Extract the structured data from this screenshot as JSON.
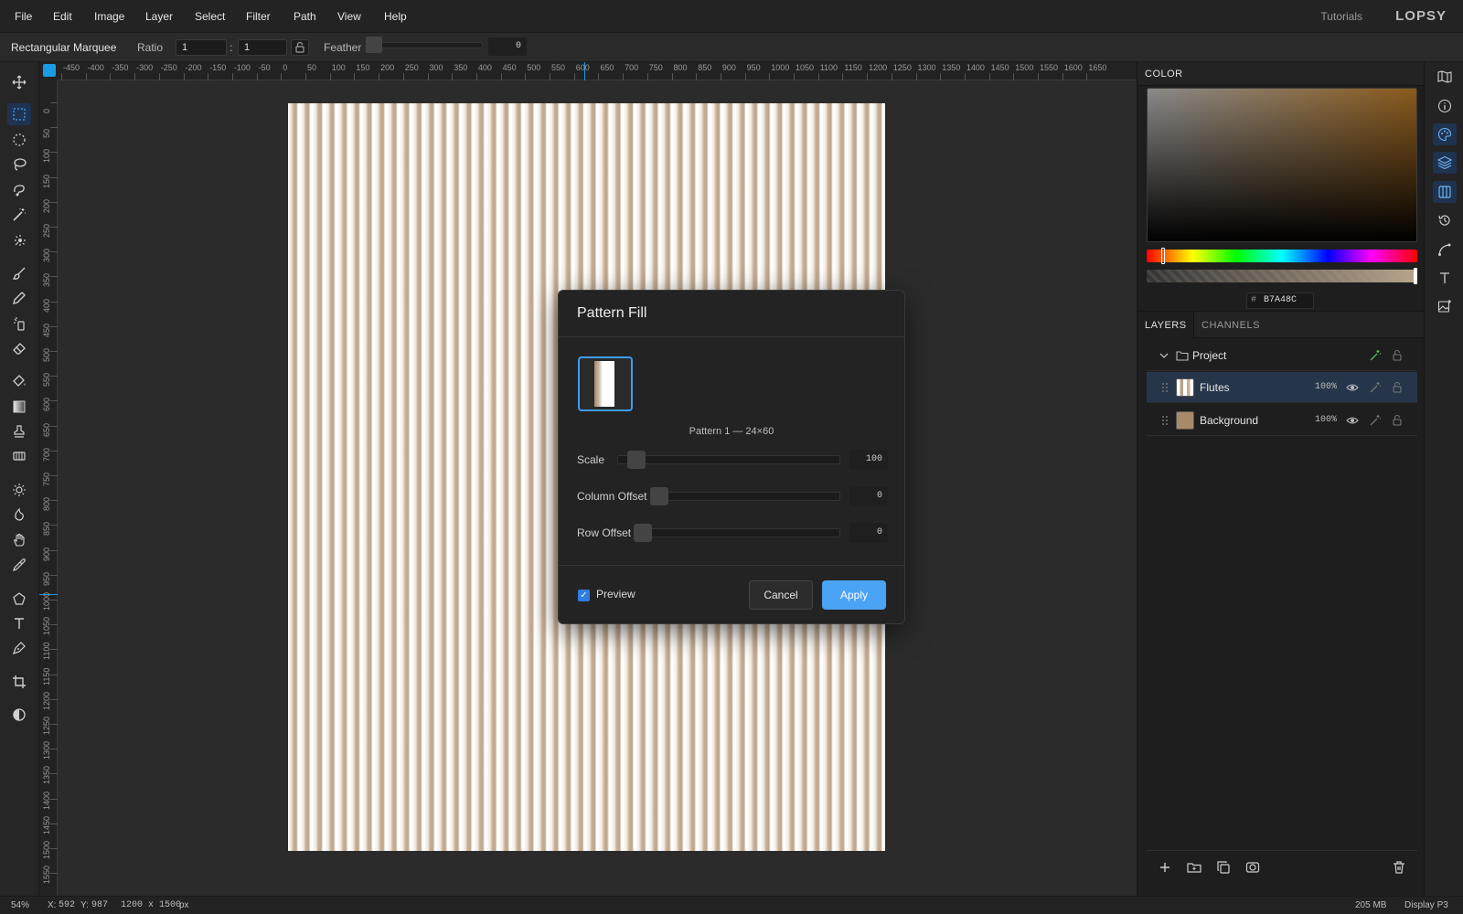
{
  "menu": [
    "File",
    "Edit",
    "Image",
    "Layer",
    "Select",
    "Filter",
    "Path",
    "View",
    "Help"
  ],
  "header": {
    "tutorials": "Tutorials",
    "logo": "LOPSY"
  },
  "options": {
    "tool_name": "Rectangular Marquee",
    "ratio_label": "Ratio",
    "ratio_w": "1",
    "ratio_sep": ":",
    "ratio_h": "1",
    "feather_label": "Feather",
    "feather_value": "0"
  },
  "tools": [
    "move-icon",
    "rect-marquee-icon",
    "ellipse-marquee-icon",
    "lasso-icon",
    "magnetic-lasso-icon",
    "magic-wand-icon",
    "quick-select-icon",
    "brush-icon",
    "pencil-icon",
    "clone-icon",
    "eraser-icon",
    "bucket-icon",
    "gradient-icon",
    "stamp-icon",
    "pattern-stamp-icon",
    "dodge-icon",
    "burn-icon",
    "hand-icon",
    "eyedropper-icon",
    "polygon-icon",
    "text-icon",
    "pen-icon",
    "crop-icon",
    "contrast-icon"
  ],
  "ruler_top": [
    "-450",
    "-400",
    "-350",
    "-300",
    "-250",
    "-200",
    "-150",
    "-100",
    "-50",
    "0",
    "50",
    "100",
    "150",
    "200",
    "250",
    "300",
    "350",
    "400",
    "450",
    "500",
    "550",
    "600",
    "650",
    "700",
    "750",
    "800",
    "850",
    "900",
    "950",
    "1000",
    "1050",
    "1100",
    "1150",
    "1200",
    "1250",
    "1300",
    "1350",
    "1400",
    "1450",
    "1500",
    "1550",
    "1600",
    "1650"
  ],
  "ruler_left": [
    "0",
    "50",
    "100",
    "150",
    "200",
    "250",
    "300",
    "350",
    "400",
    "450",
    "500",
    "550",
    "600",
    "650",
    "700",
    "750",
    "800",
    "850",
    "900",
    "950",
    "1000",
    "1050",
    "1100",
    "1150",
    "1200",
    "1250",
    "1300",
    "1350",
    "1400",
    "1450",
    "1500",
    "1550"
  ],
  "dialog": {
    "title": "Pattern Fill",
    "pattern_caption": "Pattern 1 — 24×60",
    "sliders": [
      {
        "label": "Scale",
        "value": "100",
        "level": 0.05
      },
      {
        "label": "Column Offset",
        "value": "0",
        "level": 0
      },
      {
        "label": "Row Offset",
        "value": "0",
        "level": 0
      }
    ],
    "preview_label": "Preview",
    "preview_checked": true,
    "cancel": "Cancel",
    "apply": "Apply"
  },
  "color_panel": {
    "tab": "COLOR",
    "hex_hash": "#",
    "hex": "B7A48C"
  },
  "layers_panel": {
    "tab_layers": "LAYERS",
    "tab_channels": "CHANNELS",
    "group": {
      "name": "Project"
    },
    "layers": [
      {
        "name": "Flutes",
        "opacity": "100%",
        "selected": true
      },
      {
        "name": "Background",
        "opacity": "100%",
        "selected": false
      }
    ]
  },
  "rail": [
    "map-icon",
    "info-icon",
    "palette-icon",
    "layers-icon",
    "columns-icon",
    "history-icon",
    "path-icon",
    "type-icon",
    "image-plus-icon"
  ],
  "status": {
    "zoom": "54%",
    "x_label": "X:",
    "x": "592",
    "y_label": "Y:",
    "y": "987",
    "doc_size": "1200 x 1500",
    "doc_unit": "px",
    "memory": "205 MB",
    "color_profile": "Display P3"
  },
  "colors": {
    "accent": "#4aa3f5",
    "selection": "#1a9be6",
    "fg_color": "#B7A48C"
  }
}
